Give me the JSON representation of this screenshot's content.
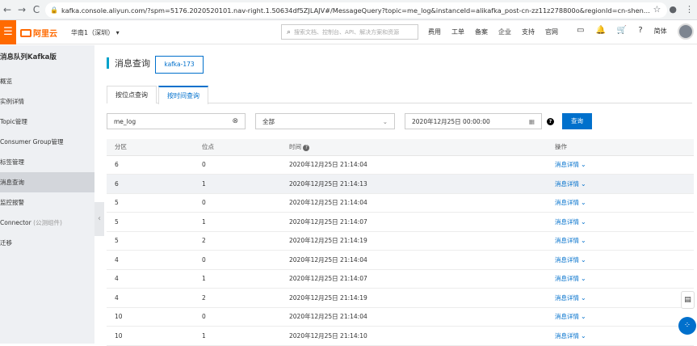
{
  "browser": {
    "back": "←",
    "forward": "→",
    "reload": "C",
    "url": "kafka.console.aliyun.com/?spm=5176.2020520101.nav-right.1.50634df5ZJLAJV#/MessageQuery?topic=me_log&instanceId=alikafka_post-cn-zz11z278800o&regionId=cn-shen…"
  },
  "topnav": {
    "menu_icon": "☰",
    "logo": "阿里云",
    "region": "华南1（深圳）",
    "search_placeholder": "搜索文档、控制台、API、解决方案和资源",
    "links": [
      "费用",
      "工单",
      "备案",
      "企业",
      "支持",
      "官网"
    ],
    "lang": "简体"
  },
  "sidebar": {
    "title": "消息队列Kafka版",
    "items": [
      {
        "label": "概览"
      },
      {
        "label": "实例详情"
      },
      {
        "label": "Topic管理"
      },
      {
        "label": "Consumer Group管理"
      },
      {
        "label": "标签管理"
      },
      {
        "label": "消息查询"
      },
      {
        "label": "监控报警"
      },
      {
        "label": "Connector",
        "extra": " (公测组件)"
      },
      {
        "label": "迁移"
      }
    ]
  },
  "page": {
    "title": "消息查询",
    "topic_chip": "kafka-173",
    "tabs": [
      "按位点查询",
      "按时间查询"
    ],
    "topic_value": "me_log",
    "partition_value": "全部",
    "time_value": "2020年12月25日 00:00:00",
    "query_button": "查询"
  },
  "table": {
    "headers": [
      "分区",
      "位点",
      "时间",
      "操作"
    ],
    "action_label": "消息详情",
    "rows": [
      [
        "6",
        "0",
        "2020年12月25日 21:14:04"
      ],
      [
        "6",
        "1",
        "2020年12月25日 21:14:13"
      ],
      [
        "5",
        "0",
        "2020年12月25日 21:14:04"
      ],
      [
        "5",
        "1",
        "2020年12月25日 21:14:07"
      ],
      [
        "5",
        "2",
        "2020年12月25日 21:14:19"
      ],
      [
        "4",
        "0",
        "2020年12月25日 21:14:04"
      ],
      [
        "4",
        "1",
        "2020年12月25日 21:14:07"
      ],
      [
        "4",
        "2",
        "2020年12月25日 21:14:19"
      ],
      [
        "10",
        "0",
        "2020年12月25日 21:14:04"
      ],
      [
        "10",
        "1",
        "2020年12月25日 21:14:10"
      ]
    ]
  }
}
